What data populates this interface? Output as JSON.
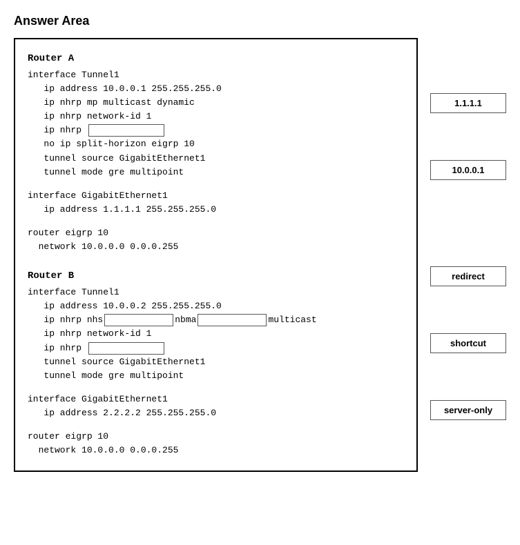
{
  "page": {
    "title": "Answer Area"
  },
  "answer_box": {
    "router_a_label": "Router A",
    "router_a_lines": [
      "interface Tunnel1",
      "   ip address 10.0.0.1 255.255.255.0",
      "   ip nhrp mp multicast dynamic",
      "   ip nhrp network-id 1",
      "   ip nhrp ",
      "   no ip split-horizon eigrp 10",
      "   tunnel source GigabitEthernet1",
      "   tunnel mode gre multipoint",
      "",
      "interface GigabitEthernet1",
      "   ip address 1.1.1.1 255.255.255.0",
      "",
      "router eigrp 10",
      "  network 10.0.0.0 0.0.0.255"
    ],
    "router_b_label": "Router B",
    "router_b_lines": [
      "interface Tunnel1",
      "   ip address 10.0.0.2 255.255.255.0",
      "   ip nhrp nhs",
      "   ip nhrp network-id 1",
      "   ip nhrp ",
      "   tunnel source GigabitEthernet1",
      "   tunnel mode gre multipoint",
      "",
      "interface GigabitEthernet1",
      "   ip address 2.2.2.2 255.255.255.0",
      "",
      "router eigrp 10",
      "  network 10.0.0.0 0.0.0.255"
    ]
  },
  "sidebar": {
    "options": [
      {
        "id": "opt-1111",
        "label": "1.1.1.1"
      },
      {
        "id": "opt-10001",
        "label": "10.0.0.1"
      },
      {
        "id": "opt-redirect",
        "label": "redirect"
      },
      {
        "id": "opt-shortcut",
        "label": "shortcut"
      },
      {
        "id": "opt-serveronly",
        "label": "server-only"
      }
    ]
  }
}
